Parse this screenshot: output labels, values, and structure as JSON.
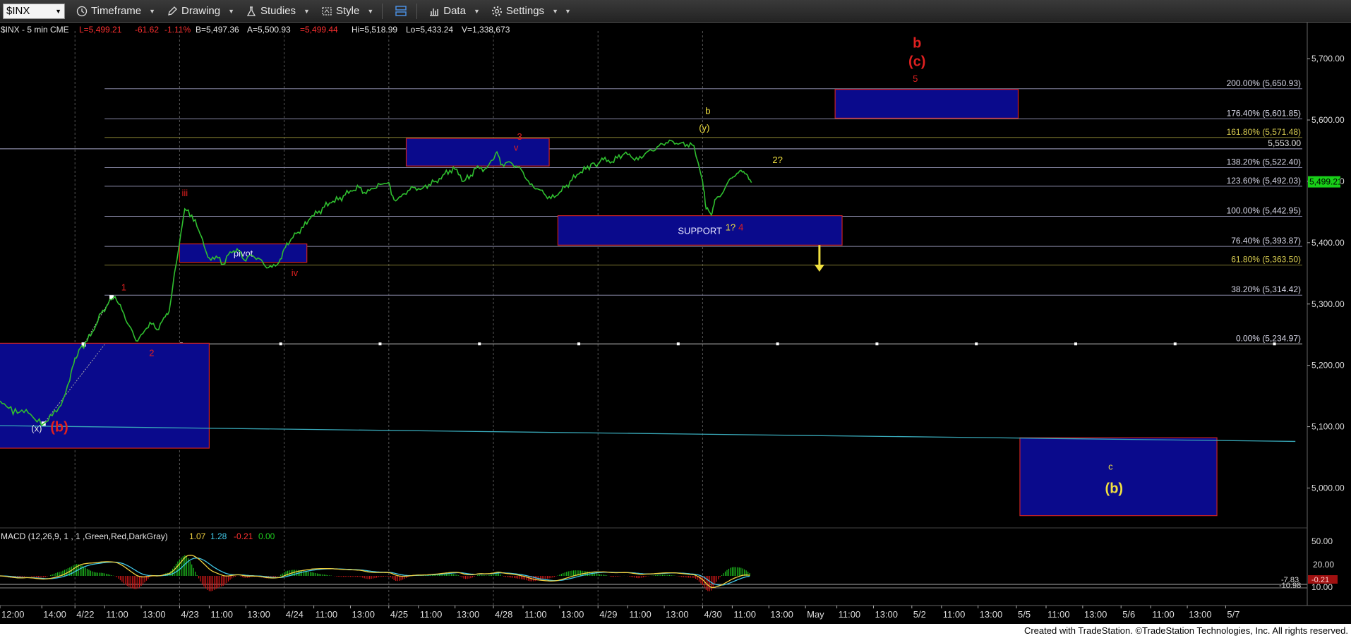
{
  "toolbar": {
    "symbol": "$INX",
    "items": [
      "Timeframe",
      "Drawing",
      "Studies",
      "Style",
      "Data",
      "Settings"
    ]
  },
  "header": {
    "symbol_info": "$INX - 5 min  CME",
    "last": "L=5,499.21",
    "change": "-61.62",
    "pct": "-1.11%",
    "bid": "B=5,497.36",
    "ask": "A=5,500.93",
    "last2": "=5,499.44",
    "hi": "Hi=5,518.99",
    "lo": "Lo=5,433.24",
    "vol": "V=1,338,673"
  },
  "macd": {
    "title": "MACD (12,26,9, 1 , 1 ,Green,Red,DarkGray)",
    "macd_value": "1.07",
    "signal_value": "1.28",
    "hist_value": "-0.21",
    "zero_value": "0.00",
    "axis_labels": [
      "50.00",
      "20.00",
      "10.00"
    ],
    "right_tags": [
      "-7.83",
      "-10.98",
      "-0.21"
    ]
  },
  "footer": {
    "credit": "Created with TradeStation. ©TradeStation Technologies, Inc. All rights reserved."
  },
  "colors": {
    "price": "#2fbf2f",
    "wave_red": "#e02020",
    "wave_yellow": "#f0e040",
    "box_fill": "#0a0a8c",
    "box_border": "#cc2222",
    "fib_line": "#8a8aa8",
    "last_tag": "#18d018"
  },
  "chart_data": {
    "type": "line",
    "title": "",
    "interval": "5 min",
    "ylim": [
      4935,
      5745
    ],
    "y_ticks": [
      5000,
      5100,
      5200,
      5300,
      5400,
      5500,
      5600,
      5700
    ],
    "y_tick_labels": [
      "5,000.00",
      "5,100.00",
      "5,200.00",
      "5,300.00",
      "5,400.00",
      "5,500.00",
      "5,600.00",
      "5,700.00"
    ],
    "x_labels": [
      "12:00",
      "14:00",
      "4/22",
      "11:00",
      "13:00",
      "4/23",
      "11:00",
      "13:00",
      "4/24",
      "11:00",
      "13:00",
      "4/25",
      "11:00",
      "13:00",
      "4/28",
      "11:00",
      "13:00",
      "4/29",
      "11:00",
      "13:00",
      "4/30",
      "11:00",
      "13:00",
      "May",
      "11:00",
      "13:00",
      "5/2",
      "11:00",
      "13:00",
      "5/5",
      "11:00",
      "13:00",
      "5/6",
      "11:00",
      "13:00",
      "5/7"
    ],
    "x_label_bars": [
      0,
      24,
      43,
      60,
      81,
      103,
      120,
      141,
      163,
      180,
      201,
      223,
      240,
      261,
      283,
      300,
      321,
      343,
      360,
      381,
      403,
      420,
      441,
      462,
      480,
      501,
      523,
      540,
      561,
      583,
      600,
      621,
      643,
      660,
      681,
      703
    ],
    "session_breaks": [
      43,
      103,
      163,
      223,
      283,
      343,
      403
    ],
    "price_series": [
      [
        0,
        5142
      ],
      [
        5,
        5130
      ],
      [
        10,
        5122
      ],
      [
        15,
        5128
      ],
      [
        20,
        5112
      ],
      [
        25,
        5105
      ],
      [
        30,
        5118
      ],
      [
        35,
        5135
      ],
      [
        40,
        5175
      ],
      [
        43,
        5212
      ],
      [
        46,
        5228
      ],
      [
        50,
        5240
      ],
      [
        54,
        5258
      ],
      [
        58,
        5285
      ],
      [
        62,
        5300
      ],
      [
        66,
        5312
      ],
      [
        70,
        5290
      ],
      [
        74,
        5265
      ],
      [
        78,
        5240
      ],
      [
        82,
        5252
      ],
      [
        86,
        5270
      ],
      [
        90,
        5258
      ],
      [
        94,
        5278
      ],
      [
        97,
        5288
      ],
      [
        103,
        5400
      ],
      [
        106,
        5455
      ],
      [
        110,
        5445
      ],
      [
        114,
        5420
      ],
      [
        117,
        5395
      ],
      [
        120,
        5375
      ],
      [
        124,
        5378
      ],
      [
        128,
        5365
      ],
      [
        132,
        5385
      ],
      [
        136,
        5390
      ],
      [
        140,
        5372
      ],
      [
        144,
        5380
      ],
      [
        148,
        5375
      ],
      [
        152,
        5362
      ],
      [
        156,
        5360
      ],
      [
        160,
        5368
      ],
      [
        163,
        5390
      ],
      [
        166,
        5400
      ],
      [
        170,
        5415
      ],
      [
        174,
        5425
      ],
      [
        178,
        5440
      ],
      [
        182,
        5448
      ],
      [
        186,
        5458
      ],
      [
        190,
        5465
      ],
      [
        194,
        5470
      ],
      [
        198,
        5478
      ],
      [
        202,
        5484
      ],
      [
        206,
        5490
      ],
      [
        210,
        5480
      ],
      [
        214,
        5488
      ],
      [
        218,
        5495
      ],
      [
        223,
        5498
      ],
      [
        226,
        5470
      ],
      [
        230,
        5475
      ],
      [
        234,
        5485
      ],
      [
        238,
        5490
      ],
      [
        242,
        5488
      ],
      [
        246,
        5495
      ],
      [
        250,
        5500
      ],
      [
        254,
        5510
      ],
      [
        258,
        5518
      ],
      [
        262,
        5520
      ],
      [
        266,
        5500
      ],
      [
        270,
        5510
      ],
      [
        274,
        5525
      ],
      [
        278,
        5520
      ],
      [
        283,
        5535
      ],
      [
        285,
        5548
      ],
      [
        288,
        5528
      ],
      [
        292,
        5532
      ],
      [
        296,
        5525
      ],
      [
        300,
        5515
      ],
      [
        304,
        5495
      ],
      [
        308,
        5488
      ],
      [
        312,
        5480
      ],
      [
        316,
        5472
      ],
      [
        320,
        5478
      ],
      [
        324,
        5490
      ],
      [
        328,
        5502
      ],
      [
        332,
        5512
      ],
      [
        336,
        5520
      ],
      [
        340,
        5530
      ],
      [
        343,
        5528
      ],
      [
        346,
        5535
      ],
      [
        350,
        5530
      ],
      [
        354,
        5538
      ],
      [
        358,
        5545
      ],
      [
        362,
        5540
      ],
      [
        366,
        5535
      ],
      [
        370,
        5545
      ],
      [
        374,
        5550
      ],
      [
        378,
        5558
      ],
      [
        382,
        5563
      ],
      [
        386,
        5565
      ],
      [
        390,
        5562
      ],
      [
        394,
        5560
      ],
      [
        398,
        5558
      ],
      [
        403,
        5500
      ],
      [
        405,
        5455
      ],
      [
        408,
        5445
      ],
      [
        410,
        5470
      ],
      [
        413,
        5475
      ],
      [
        416,
        5490
      ],
      [
        419,
        5505
      ],
      [
        422,
        5510
      ],
      [
        425,
        5518
      ],
      [
        428,
        5512
      ],
      [
        431,
        5498
      ]
    ],
    "fib_levels": [
      {
        "pct_label": "200.00% (5,650.93)",
        "value": 5650.93
      },
      {
        "pct_label": "176.40% (5,601.85)",
        "value": 5601.85
      },
      {
        "pct_label": "161.80% (5,571.48)",
        "value": 5571.48
      },
      {
        "pct_label": "138.20% (5,522.40)",
        "value": 5522.4
      },
      {
        "pct_label": "123.60% (5,492.03)",
        "value": 5492.03
      },
      {
        "pct_label": "100.00% (5,442.95)",
        "value": 5442.95
      },
      {
        "pct_label": "76.40% (5,393.87)",
        "value": 5393.87
      },
      {
        "pct_label": "61.80% (5,363.50)",
        "value": 5363.5
      },
      {
        "pct_label": "38.20% (5,314.42)",
        "value": 5314.42
      },
      {
        "pct_label": "0.00% (5,234.97)",
        "value": 5234.97
      }
    ],
    "fib_start_bar": 60,
    "horizontal_line": {
      "label": "5,553.00",
      "value": 5553.0
    },
    "last_price": {
      "label": "5,499.21",
      "value": 5499.21
    },
    "trendline": {
      "x1": -10,
      "y1": 5102,
      "x2": 743,
      "y2": 5076
    },
    "boxes": [
      {
        "x1": -5,
        "x2": 120,
        "y1": 5065,
        "y2": 5236,
        "label": ""
      },
      {
        "x1": 103,
        "x2": 176,
        "y1": 5368,
        "y2": 5398,
        "label": "pivot"
      },
      {
        "x1": 233,
        "x2": 315,
        "y1": 5525,
        "y2": 5570,
        "label": ""
      },
      {
        "x1": 320,
        "x2": 483,
        "y1": 5396,
        "y2": 5444,
        "label": "SUPPORT"
      },
      {
        "x1": 479,
        "x2": 584,
        "y1": 5603,
        "y2": 5650,
        "label": ""
      },
      {
        "x1": 585,
        "x2": 698,
        "y1": 4955,
        "y2": 5082,
        "label": ""
      }
    ],
    "wave_labels": [
      {
        "text": "(x)",
        "bar": 21,
        "price": 5092,
        "color": "white"
      },
      {
        "text": "(b)",
        "bar": 34,
        "price": 5092,
        "color": "red"
      },
      {
        "text": "1",
        "bar": 71,
        "price": 5322,
        "color": "red"
      },
      {
        "text": "2",
        "bar": 87,
        "price": 5215,
        "color": "red"
      },
      {
        "text": "iii",
        "bar": 106,
        "price": 5476,
        "color": "red"
      },
      {
        "text": "iv",
        "bar": 169,
        "price": 5346,
        "color": "red"
      },
      {
        "text": "3",
        "bar": 298,
        "price": 5568,
        "color": "red"
      },
      {
        "text": "v",
        "bar": 296,
        "price": 5550,
        "color": "red"
      },
      {
        "text": "b",
        "bar": 406,
        "price": 5610,
        "color": "yellow"
      },
      {
        "text": "(y)",
        "bar": 404,
        "price": 5582,
        "color": "yellow"
      },
      {
        "text": "2?",
        "bar": 446,
        "price": 5530,
        "color": "yellow"
      },
      {
        "text": "1?",
        "bar": 419,
        "price": 5420,
        "color": "yellow"
      },
      {
        "text": "4",
        "bar": 425,
        "price": 5420,
        "color": "red"
      },
      {
        "text": "b",
        "bar": 526,
        "price": 5718,
        "color": "red"
      },
      {
        "text": "(c)",
        "bar": 526,
        "price": 5688,
        "color": "red"
      },
      {
        "text": "5",
        "bar": 525,
        "price": 5662,
        "color": "red"
      },
      {
        "text": "c",
        "bar": 637,
        "price": 5030,
        "color": "yellow"
      },
      {
        "text": "(b)",
        "bar": 639,
        "price": 4992,
        "color": "yellow"
      }
    ],
    "arrow": {
      "bar": 470,
      "from": 5396,
      "to": 5355,
      "color": "yellow"
    }
  }
}
